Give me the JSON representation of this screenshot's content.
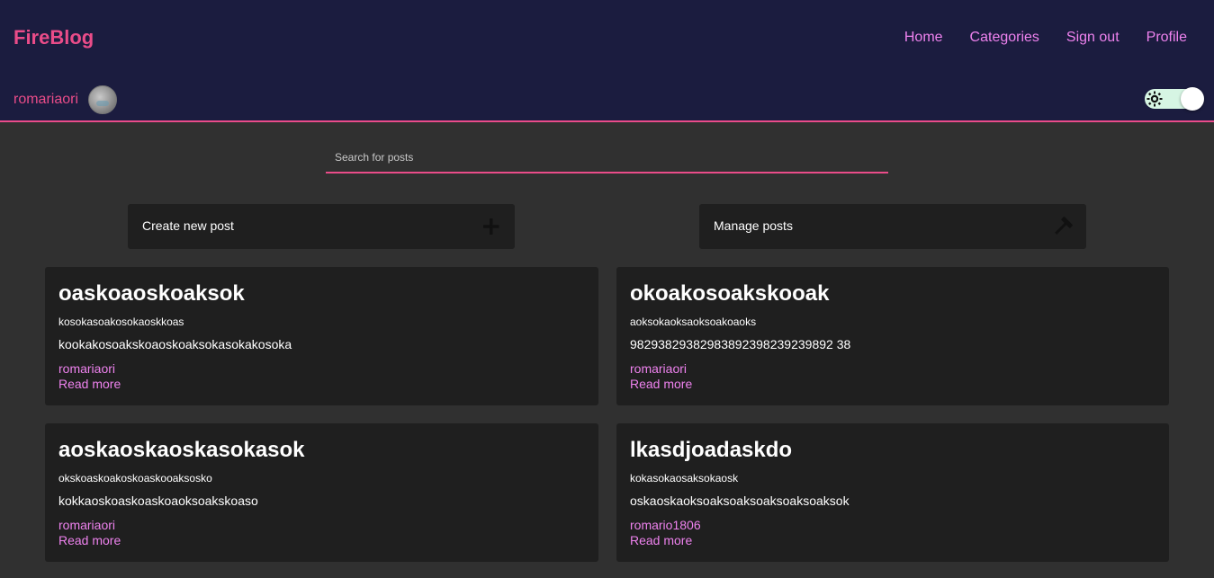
{
  "header": {
    "brand": "FireBlog",
    "nav": [
      "Home",
      "Categories",
      "Sign out",
      "Profile"
    ],
    "username": "romariaori",
    "theme_toggle": {
      "icon": "gear-sun-icon",
      "state": "on"
    }
  },
  "search": {
    "placeholder": "Search for posts",
    "value": ""
  },
  "actions": {
    "create_label": "Create new post",
    "create_icon": "plus-icon",
    "manage_label": "Manage posts",
    "manage_icon": "hammer-icon"
  },
  "posts": [
    {
      "title": "oaskoaoskoaksok",
      "subtitle": "kosokasoakosokaoskkoas",
      "body": "kookakosoakskoaoskoaksokasokakosoka",
      "author": "romariaori",
      "read_more": "Read more"
    },
    {
      "title": "okoakosoakskooak",
      "subtitle": "aoksokaoksaoksoakoaoks",
      "body": "98293829382983892398239239892 38",
      "author": "romariaori",
      "read_more": "Read more"
    },
    {
      "title": "aoskaoskaoskasokasok",
      "subtitle": "okskoaskoakoskoaskooaksosko",
      "body": "kokkaoskoaskoaskoaoksoakskoaso",
      "author": "romariaori",
      "read_more": "Read more"
    },
    {
      "title": "lkasdjoadaskdo",
      "subtitle": "kokasokaosaksokaosk",
      "body": "oskaoskaoksoaksoaksoaksoaksoaksok",
      "author": "romario1806",
      "read_more": "Read more"
    }
  ],
  "colors": {
    "header_bg": "#1b1c3f",
    "accent": "#ea4c89",
    "link": "#ee82ee",
    "page_bg": "#303030",
    "card_bg": "#1f1f1f"
  }
}
